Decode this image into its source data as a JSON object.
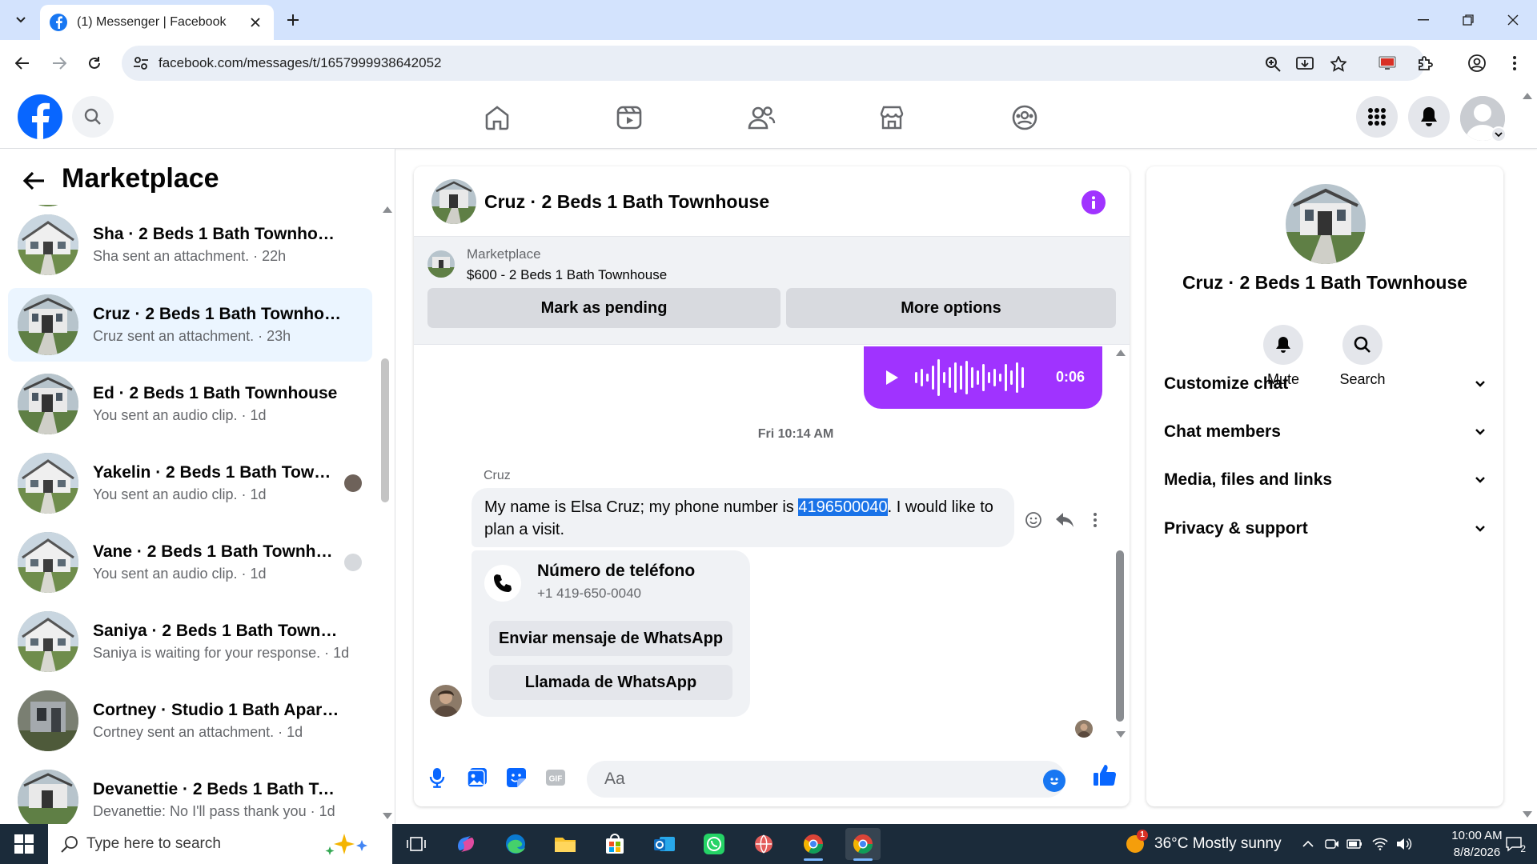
{
  "browser": {
    "tab_title": "(1) Messenger | Facebook",
    "url": "facebook.com/messages/t/1657999938642052"
  },
  "left": {
    "title": "Marketplace",
    "conversations": [
      {
        "name": "Sha · 2 Beds 1 Bath Townhouse",
        "sub": "Sha sent an attachment. · 22h"
      },
      {
        "name": "Cruz · 2 Beds 1 Bath Townhouse",
        "sub": "Cruz sent an attachment. · 23h"
      },
      {
        "name": "Ed · 2 Beds 1 Bath Townhouse",
        "sub": "You sent an audio clip. · 1d"
      },
      {
        "name": "Yakelin · 2 Beds 1 Bath Townh...",
        "sub": "You sent an audio clip. · 1d"
      },
      {
        "name": "Vane · 2 Beds 1 Bath Townhouse",
        "sub": "You sent an audio clip. · 1d"
      },
      {
        "name": "Saniya · 2 Beds 1 Bath Townhouse",
        "sub": "Saniya is waiting for your response. · 1d"
      },
      {
        "name": "Cortney · Studio 1 Bath Apartment",
        "sub": "Cortney sent an attachment. · 1d"
      },
      {
        "name": "Devanettie · 2 Beds 1 Bath Town...",
        "sub": "Devanettie: No I'll pass thank you · 1d"
      }
    ]
  },
  "chat": {
    "header_name": "Cruz · 2 Beds 1 Bath Townhouse",
    "banner_label": "Marketplace",
    "banner_listing": "$600 - 2 Beds 1 Bath Townhouse",
    "btn_pending": "Mark as pending",
    "btn_more": "More options",
    "audio_duration": "0:06",
    "timestamp": "Fri 10:14 AM",
    "sender": "Cruz",
    "message_before": "My name is Elsa Cruz; my phone number is ",
    "message_highlight": "4196500040",
    "message_after": ". I would like to plan a visit.",
    "card_title": "Número de teléfono",
    "card_phone": "+1 419-650-0040",
    "card_btn_whatsapp_msg": "Enviar mensaje de WhatsApp",
    "card_btn_whatsapp_call": "Llamada de WhatsApp",
    "input_placeholder": "Aa"
  },
  "right": {
    "name": "Cruz · 2 Beds 1 Bath Townhouse",
    "mute_label": "Mute",
    "search_label": "Search",
    "sections": [
      "Customize chat",
      "Chat members",
      "Media, files and links",
      "Privacy & support"
    ]
  },
  "taskbar": {
    "search_placeholder": "Type here to search",
    "weather": "36°C  Mostly sunny",
    "time": "10:00 AM",
    "date": "8/8/2026",
    "notification_count": "2"
  },
  "colors": {
    "fb_blue": "#0866ff",
    "messenger_purple": "#a033ff",
    "highlight": "#1a73e8",
    "active_row": "#ebf5ff"
  }
}
